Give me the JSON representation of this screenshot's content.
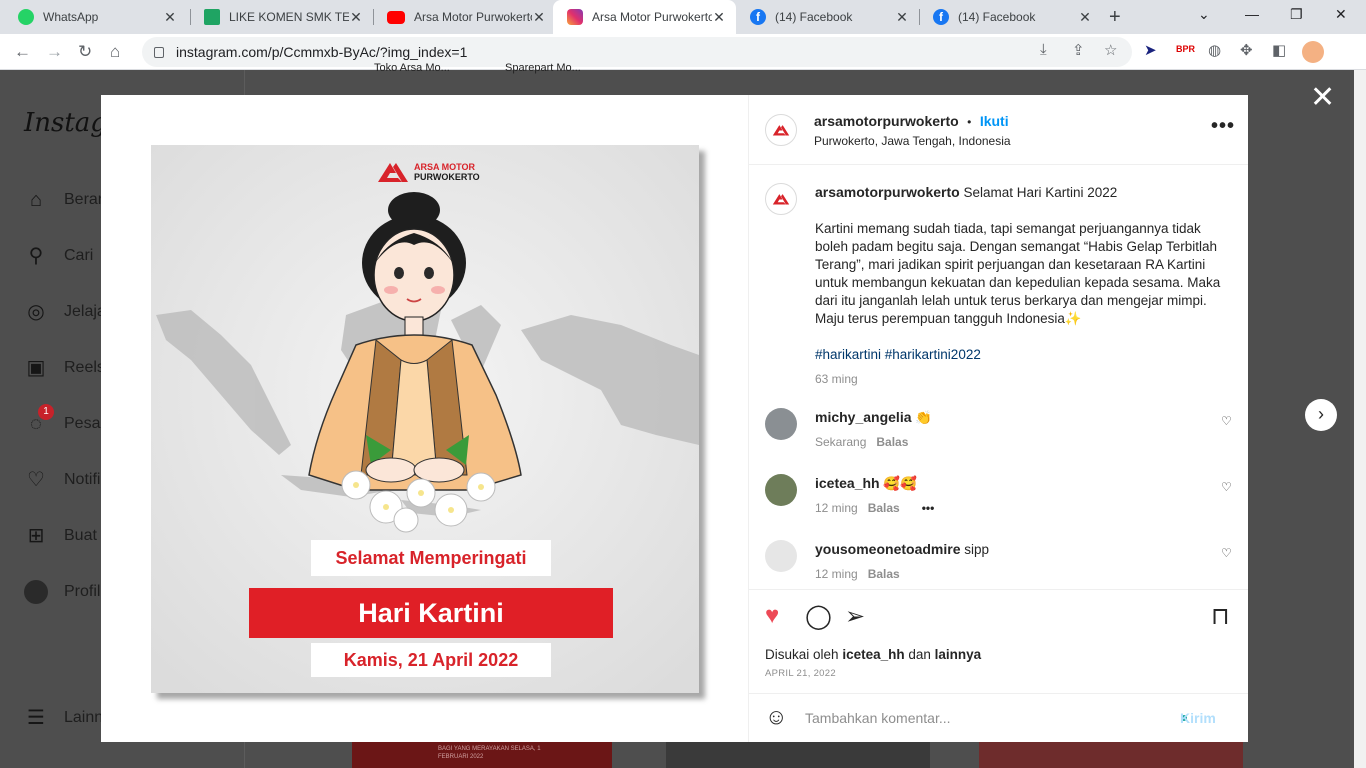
{
  "browser": {
    "tabs": [
      {
        "title": "WhatsApp",
        "icon": "whatsapp-icon"
      },
      {
        "title": "LIKE KOMEN SMK TELKO",
        "icon": "sheets-icon"
      },
      {
        "title": "Arsa Motor Purwokerto",
        "icon": "youtube-icon"
      },
      {
        "title": "Arsa Motor Purwokerto",
        "icon": "instagram-icon",
        "active": true
      },
      {
        "title": "(14) Facebook",
        "icon": "facebook-icon"
      },
      {
        "title": "(14) Facebook",
        "icon": "facebook-icon"
      }
    ],
    "url": "instagram.com/p/Ccmmxb-ByAc/?img_index=1",
    "extension_label": "BPR"
  },
  "sidebar": {
    "logo": "Instagram",
    "items": [
      {
        "label": "Beranda",
        "icon": "home-icon"
      },
      {
        "label": "Cari",
        "icon": "search-icon"
      },
      {
        "label": "Jelajahi",
        "icon": "compass-icon"
      },
      {
        "label": "Reels",
        "icon": "reels-icon"
      },
      {
        "label": "Pesan",
        "icon": "messenger-icon",
        "badge": "1"
      },
      {
        "label": "Notifikasi",
        "icon": "heart-icon"
      },
      {
        "label": "Buat",
        "icon": "plus-square-icon"
      },
      {
        "label": "Profil",
        "icon": "avatar-icon"
      },
      {
        "label": "Lainnya",
        "icon": "menu-icon"
      }
    ]
  },
  "background": {
    "top_labels": [
      "Toko Arsa Mo...",
      "Sparepart Mo..."
    ],
    "thumb_text": "BAGI YANG MERAYAKAN SELASA, 1 FEBRUARI 2022"
  },
  "poster": {
    "brand_line1": "ARSA MOTOR",
    "brand_line2": "PURWOKERTO",
    "greeting": "Selamat Memperingati",
    "title": "Hari Kartini",
    "date": "Kamis, 21 April 2022",
    "accent": "#e01f26"
  },
  "post": {
    "username": "arsamotorpurwokerto",
    "follow": "Ikuti",
    "separator": "•",
    "location": "Purwokerto, Jawa Tengah, Indonesia",
    "caption_title": "Selamat Hari Kartini 2022",
    "caption_body": "Kartini memang sudah tiada, tapi semangat perjuangannya tidak boleh padam begitu saja. Dengan semangat “Habis Gelap Terbitlah Terang”, mari jadikan spirit perjuangan dan kesetaraan RA Kartini untuk membangun kekuatan dan kepedulian kepada sesama. Maka dari itu janganlah lelah untuk terus berkarya dan mengejar mimpi. Maju terus perempuan tangguh Indonesia✨",
    "hashtags": "#harikartini #harikartini2022",
    "caption_time": "63 ming",
    "comments": [
      {
        "user": "michy_angelia",
        "text": "👏",
        "time": "Sekarang",
        "reply": "Balas"
      },
      {
        "user": "icetea_hh",
        "text": "🥰🥰",
        "time": "12 ming",
        "reply": "Balas",
        "more": "•••"
      },
      {
        "user": "yousomeonetoadmire",
        "text": "sipp",
        "time": "12 ming",
        "reply": "Balas"
      }
    ],
    "likes_prefix": "Disukai oleh",
    "likes_user": "icetea_hh",
    "likes_mid": "dan",
    "likes_others": "lainnya",
    "date": "APRIL 21, 2022",
    "comment_placeholder": "Tambahkan komentar...",
    "send_label": "Kirim"
  }
}
